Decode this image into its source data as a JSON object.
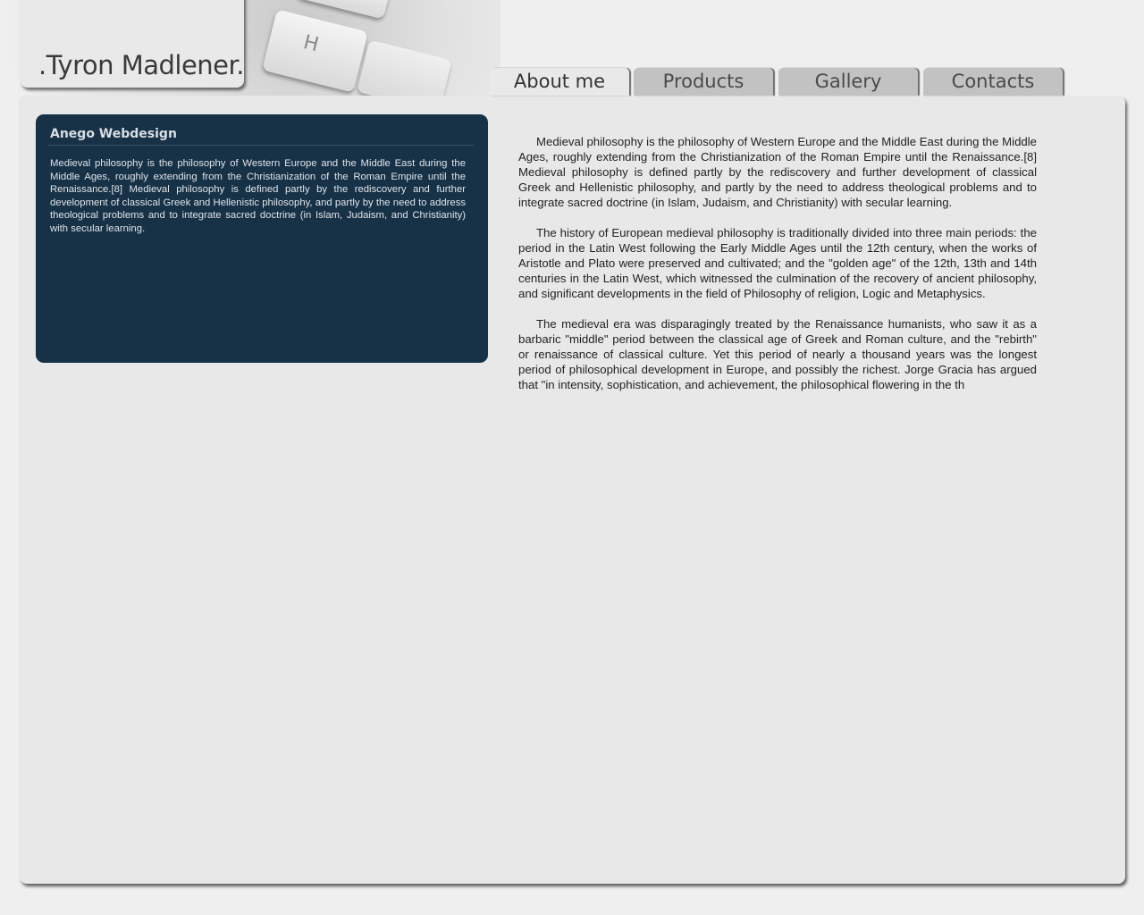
{
  "site": {
    "logo": ".Tyron Madlener."
  },
  "nav": {
    "tabs": [
      {
        "label": "About me",
        "active": true
      },
      {
        "label": "Products",
        "active": false
      },
      {
        "label": "Gallery",
        "active": false
      },
      {
        "label": "Contacts",
        "active": false
      }
    ]
  },
  "sidebar_box": {
    "title": "Anego Webdesign",
    "text": "Medieval philosophy is the philosophy of Western Europe and the Middle East during the Middle Ages, roughly extending from the Christianization of the Roman Empire until the Renaissance.[8] Medieval philosophy is defined partly by the rediscovery and further development of classical Greek and Hellenistic philosophy, and partly by the need to address theological problems and to integrate sacred doctrine (in Islam, Judaism, and Christianity) with secular learning."
  },
  "main": {
    "paragraphs": [
      "Medieval philosophy is the philosophy of Western Europe and the Middle East during the Middle Ages, roughly extending from the Christianization of the Roman Empire until the Renaissance.[8] Medieval philosophy is defined partly by the rediscovery and further development of classical Greek and Hellenistic philosophy, and partly by the need to address theological problems and to integrate sacred doctrine (in Islam, Judaism, and Christianity) with secular learning.",
      "The history of European medieval philosophy is traditionally divided into three main periods: the period in the Latin West following the Early Middle Ages until the 12th century, when the works of Aristotle and Plato were preserved and cultivated; and the \"golden age\" of the 12th, 13th and 14th centuries in the Latin West, which witnessed the culmination of the recovery of ancient philosophy, and significant developments in the field of Philosophy of religion, Logic and Metaphysics.",
      "The medieval era was disparagingly treated by the Renaissance humanists, who saw it as a barbaric \"middle\" period between the classical age of Greek and Roman culture, and the \"rebirth\" or renaissance of classical culture. Yet this period of nearly a thousand years was the longest period of philosophical development in Europe, and possibly the richest. Jorge Gracia has argued that \"in intensity, sophistication, and achievement, the philosophical flowering in the th"
    ]
  },
  "decor": {
    "keyboard_key_letter": "H"
  },
  "colors": {
    "page_bg": "#efefef",
    "panel_bg": "#e8e8e8",
    "dark_box_bg": "#173147",
    "tab_inactive": "#c2c2c2",
    "tab_active": "#e9e9e9"
  }
}
